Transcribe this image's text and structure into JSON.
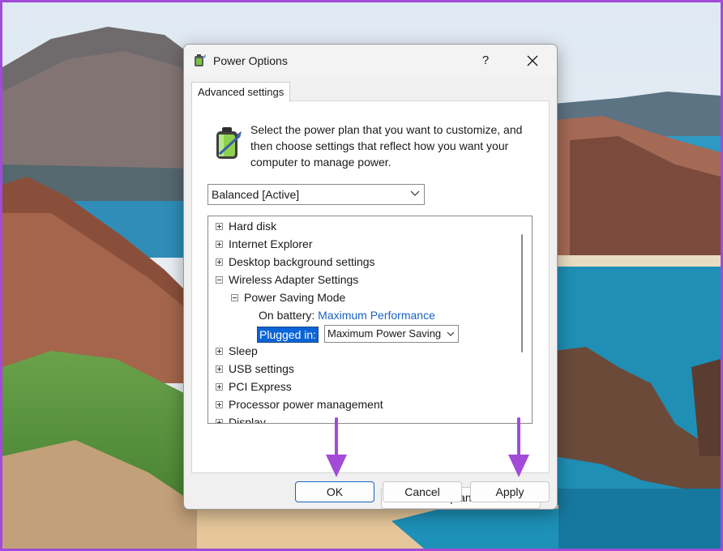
{
  "window": {
    "title": "Power Options",
    "help_label": "?",
    "close_label": "✕",
    "icon": "power-options-icon"
  },
  "tabs": [
    {
      "label": "Advanced settings",
      "selected": true
    }
  ],
  "intro_text": "Select the power plan that you want to customize, and then choose settings that reflect how you want your computer to manage power.",
  "plan_select": {
    "value": "Balanced [Active]"
  },
  "tree": {
    "items": [
      {
        "label": "Hard disk",
        "expander": "plus"
      },
      {
        "label": "Internet Explorer",
        "expander": "plus"
      },
      {
        "label": "Desktop background settings",
        "expander": "plus"
      },
      {
        "label": "Wireless Adapter Settings",
        "expander": "minus"
      },
      {
        "label": "Power Saving Mode",
        "expander": "minus"
      },
      {
        "on_battery_label": "On battery:",
        "on_battery_value": "Maximum Performance"
      },
      {
        "plugged_in_label": "Plugged in:",
        "plugged_in_value": "Maximum Power Saving"
      },
      {
        "label": "Sleep",
        "expander": "plus"
      },
      {
        "label": "USB settings",
        "expander": "plus"
      },
      {
        "label": "PCI Express",
        "expander": "plus"
      },
      {
        "label": "Processor power management",
        "expander": "plus"
      },
      {
        "label": "Display",
        "expander": "plus"
      }
    ]
  },
  "buttons": {
    "restore": "Restore plan defaults",
    "ok": "OK",
    "cancel": "Cancel",
    "apply": "Apply"
  },
  "colors": {
    "frame_border": "#a24bd8",
    "annotation_arrow": "#a24bd8",
    "link_blue": "#1a63c2",
    "selection_blue": "#0a64d6"
  }
}
